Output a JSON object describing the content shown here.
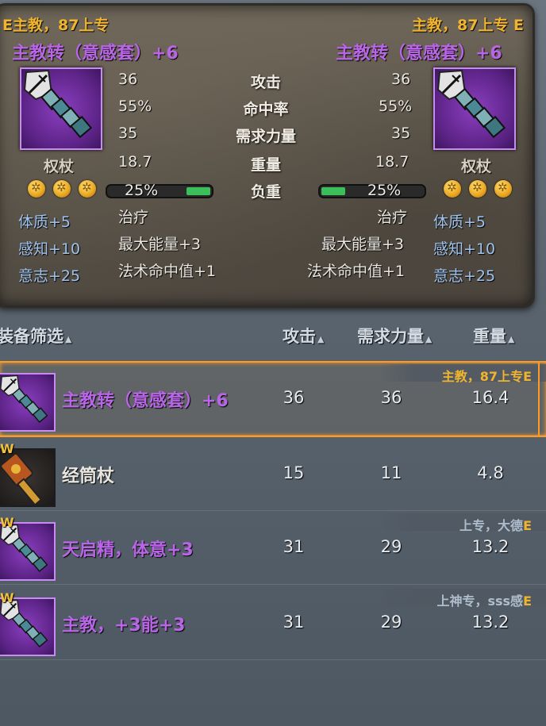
{
  "compare": {
    "left": {
      "header": "E主教，87上专",
      "title": "主教转（意感套）+6",
      "category": "权杖",
      "stats": [
        "36",
        "55%",
        "35",
        "18.7"
      ],
      "load": "25%",
      "load_fraction": 0.25,
      "effects": [
        "治疗",
        "最大能量+3",
        "法术命中值+1"
      ],
      "attrs": [
        "体质+5",
        "感知+10",
        "意志+25"
      ]
    },
    "right": {
      "header": "主教，87上专 E",
      "title": "主教转（意感套）+6",
      "category": "权杖",
      "stats": [
        "36",
        "55%",
        "35",
        "18.7"
      ],
      "load": "25%",
      "load_fraction": 0.25,
      "effects": [
        "治疗",
        "最大能量+3",
        "法术命中值+1"
      ],
      "attrs": [
        "体质+5",
        "感知+10",
        "意志+25"
      ]
    },
    "labels": [
      "攻击",
      "命中率",
      "需求力量",
      "重量",
      "负重"
    ]
  },
  "list_header": {
    "filter": "装备筛选",
    "attack": "攻击",
    "str_req": "需求力量",
    "weight": "重量"
  },
  "rows": [
    {
      "badge": "",
      "name": "主教转（意感套）+6",
      "attack": "36",
      "str": "36",
      "weight": "16.4",
      "note_prefix": "主教，87上专",
      "note_suffix": "E",
      "rarity": "purple",
      "selected": true
    },
    {
      "badge": "W",
      "name": "经筒杖",
      "attack": "15",
      "str": "11",
      "weight": "4.8",
      "note_prefix": "",
      "note_suffix": "",
      "rarity": "white",
      "selected": false
    },
    {
      "badge": "W",
      "name": "天启精，体意+3",
      "attack": "31",
      "str": "29",
      "weight": "13.2",
      "note_prefix": "上专，大德",
      "note_suffix": "E",
      "rarity": "purple",
      "selected": false
    },
    {
      "badge": "W",
      "name": "主教，+3能+3",
      "attack": "31",
      "str": "29",
      "weight": "13.2",
      "note_prefix": "上神专，sss感",
      "note_suffix": "E",
      "rarity": "purple",
      "selected": false
    }
  ],
  "colors": {
    "gold": "#f1b42f",
    "purple": "#b966e6",
    "attr_blue": "#9fc3ee",
    "highlight": "#ff9b24"
  },
  "icons": {
    "weapon": "staff-icon",
    "socket": "socket-gem-icon"
  }
}
